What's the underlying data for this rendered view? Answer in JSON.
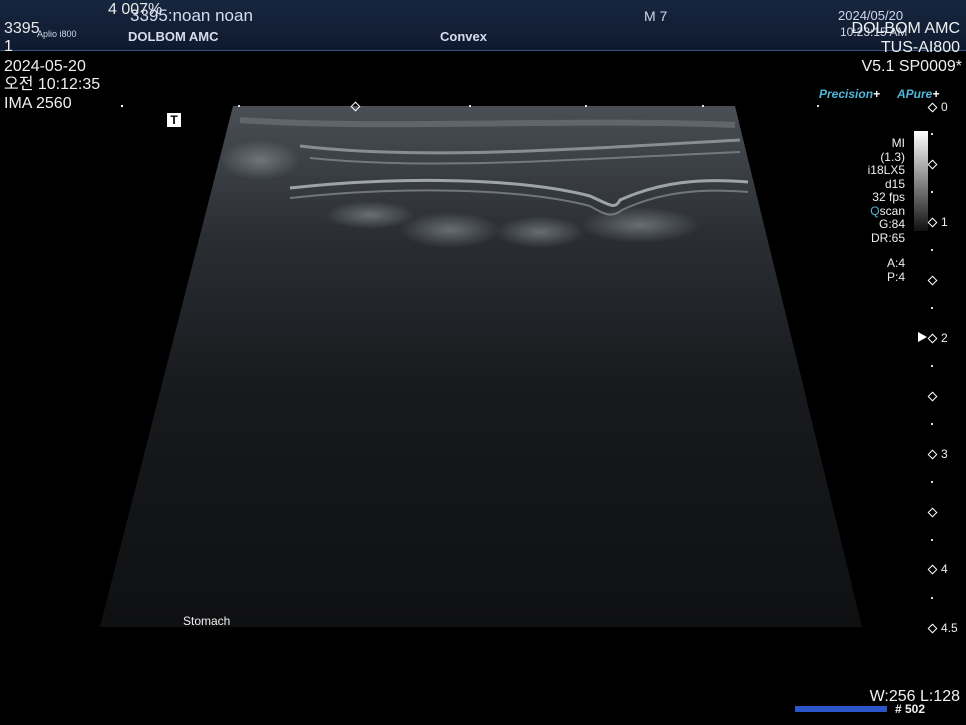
{
  "header": {
    "id_overlay": "3395",
    "top_number": "4 007%",
    "patient": "3395:noan noan",
    "device_small": "Aplio i800",
    "hospital_left": "DOLBOM AMC",
    "probe_type": "Convex",
    "mode": "M  7",
    "date_right": "2024/05/20",
    "time_right": "10:23:15 AM"
  },
  "left_overlay": {
    "line1": "1",
    "date": "2024-05-20",
    "time": "오전 10:12:35",
    "ima": "IMA 2560",
    "t_marker": "T"
  },
  "right_overlay": {
    "hospital": "DOLBOM AMC",
    "system": "TUS-AI800",
    "version": "V5.1 SP0009*"
  },
  "modes": {
    "precision_a": "Precision",
    "precision_b": "+",
    "apure_a": "A",
    "apure_b": "Pure",
    "apure_c": "+"
  },
  "params": {
    "mi_label": "MI",
    "mi_value": "(1.3)",
    "probe": "i18LX5",
    "depth": "d15",
    "fps": "32 fps",
    "qscan_q": "Q",
    "qscan_rest": "scan",
    "gain": "G:84",
    "dr": "DR:65",
    "a": "A:4",
    "p": "P:4"
  },
  "depth_labels": [
    "0",
    "1",
    "2",
    "3",
    "4",
    "4.5"
  ],
  "annotation": "Stomach",
  "window_level": "W:256 L:128",
  "frame_number": "# 502",
  "colors": {
    "header_bg": "#17263f",
    "accent_cyan": "#4fb6d9",
    "bar_blue": "#2b56c9"
  }
}
